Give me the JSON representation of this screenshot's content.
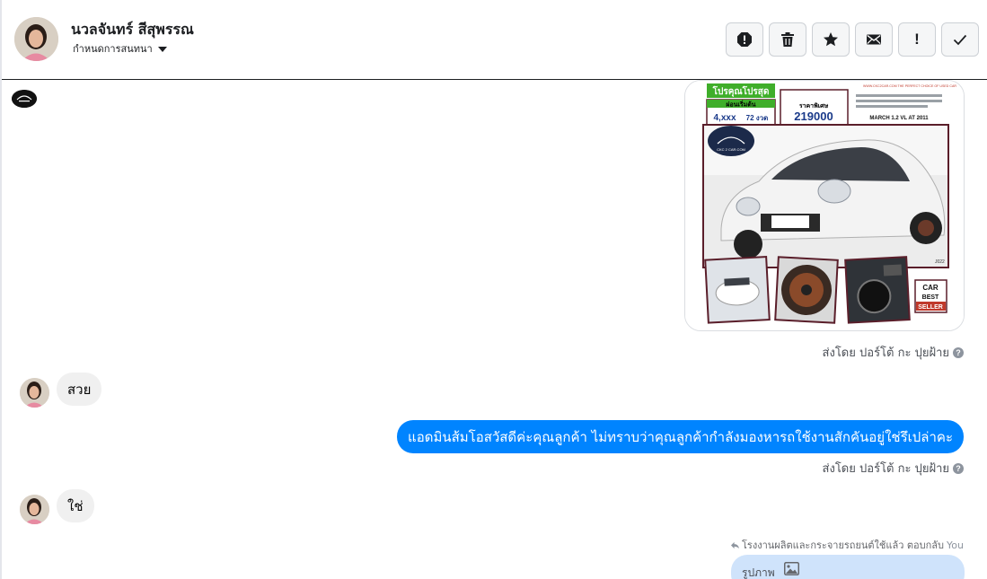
{
  "header": {
    "contact_name": "นวลจันทร์ สีสุพรรณ",
    "assign_label": "กำหนดการสนทนา",
    "toolbar": [
      "spam-icon",
      "trash-icon",
      "star-icon",
      "envelope-icon",
      "important-icon",
      "check-icon"
    ]
  },
  "car_ad": {
    "headline": "โปรคุณโปรสุด",
    "installment_label": "ผ่อนเริ่มต้น",
    "installment_value": "4,xxx",
    "term": "72 งวด",
    "price_label": "ราคาพิเศษ",
    "price": "219000",
    "model": "MARCH 1.2 VL AT 2011",
    "site": "WWW.CKC2CAR.COM THE PERFECT CHOICE OF USED CAR",
    "badge": [
      "CAR",
      "BEST",
      "SELLER"
    ],
    "brand": "CKC 2 CAR.COM",
    "code": "J022"
  },
  "messages": {
    "sent_by_1": "ส่งโดย ปอร์โต้ กะ ปุยฝ้าย",
    "incoming_1": "สวย",
    "outgoing_1": "แอดมินส้มโอสวัสดีค่ะคุณลูกค้า ไม่ทราบว่าคุณลูกค้ากำลังมองหารถใช้งานสักคันอยู่ใช่รึเปล่าคะ",
    "sent_by_2": "ส่งโดย ปอร์โต้ กะ ปุยฝ้าย",
    "incoming_2": "ใช่",
    "reply_meta": "โรงงานผลิตและกระจายรถยนต์ใช้แล้ว ตอบกลับ",
    "reply_you": "You",
    "reply_preview": "รูปภาพ"
  },
  "colors": {
    "outgoing_bubble": "#0084ff",
    "incoming_bubble": "#f0f0f0",
    "reply_bubble": "#cfe3fb"
  }
}
